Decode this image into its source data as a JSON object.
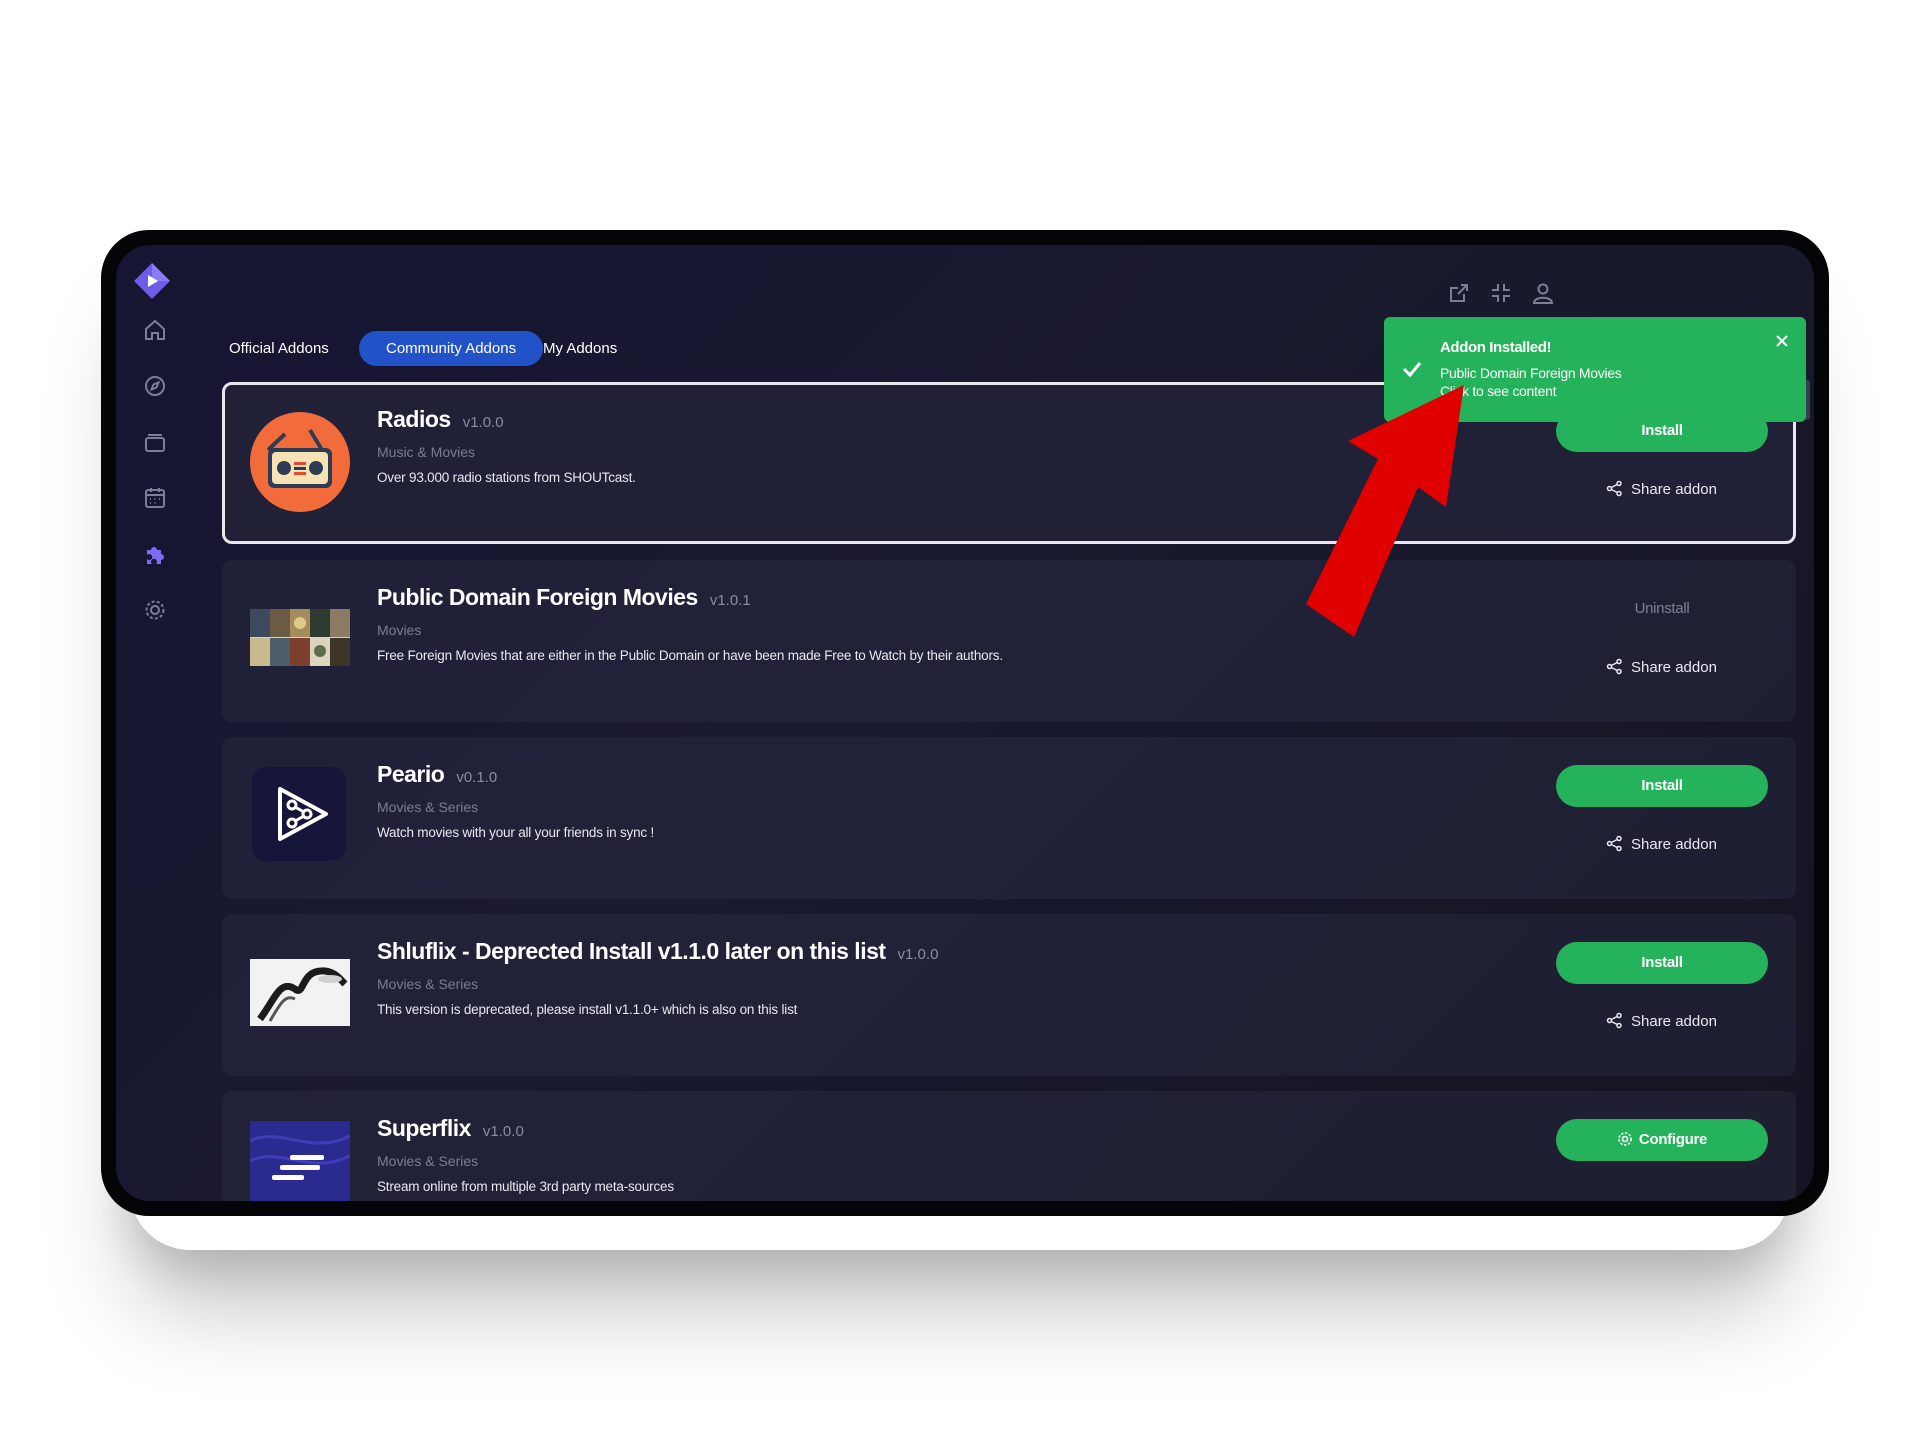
{
  "tabs": [
    {
      "label": "Official Addons",
      "active": false
    },
    {
      "label": "Community Addons",
      "active": true
    },
    {
      "label": "My Addons",
      "active": false
    }
  ],
  "sidebar": {
    "items": [
      {
        "icon": "home-icon"
      },
      {
        "icon": "compass-icon"
      },
      {
        "icon": "library-icon"
      },
      {
        "icon": "calendar-icon"
      },
      {
        "icon": "puzzle-icon",
        "active": true
      },
      {
        "icon": "gear-icon"
      }
    ]
  },
  "topbar": {
    "icons": [
      "open-external-icon",
      "minimize-icon",
      "user-icon"
    ]
  },
  "toast": {
    "title": "Addon Installed!",
    "line1": "Public Domain Foreign Movies",
    "line2": "Click to see content",
    "color": "#24b25a"
  },
  "addons": [
    {
      "name": "Radios",
      "version": "v1.0.0",
      "types": "Music & Movies",
      "description": "Over 93.000 radio stations from SHOUTcast.",
      "action": "Install",
      "share": "Share addon"
    },
    {
      "name": "Public Domain Foreign Movies",
      "version": "v1.0.1",
      "types": "Movies",
      "description": "Free Foreign Movies that are either in the Public Domain or have been made Free to Watch by their authors.",
      "action": "Uninstall",
      "share": "Share addon"
    },
    {
      "name": "Peario",
      "version": "v0.1.0",
      "types": "Movies & Series",
      "description": "Watch movies with your all your friends in sync !",
      "action": "Install",
      "share": "Share addon"
    },
    {
      "name": "Shluflix - Deprected Install v1.1.0 later on this list",
      "version": "v1.0.0",
      "types": "Movies & Series",
      "description": "This version is deprecated, please install v1.1.0+ which is also on this list",
      "action": "Install",
      "share": "Share addon"
    },
    {
      "name": "Superflix",
      "version": "v1.0.0",
      "types": "Movies & Series",
      "description": "Stream online from multiple 3rd party meta-sources",
      "action": "Configure"
    }
  ],
  "colors": {
    "accent": "#2252c8",
    "install": "#24b25a",
    "annotation_arrow": "#e00000"
  }
}
